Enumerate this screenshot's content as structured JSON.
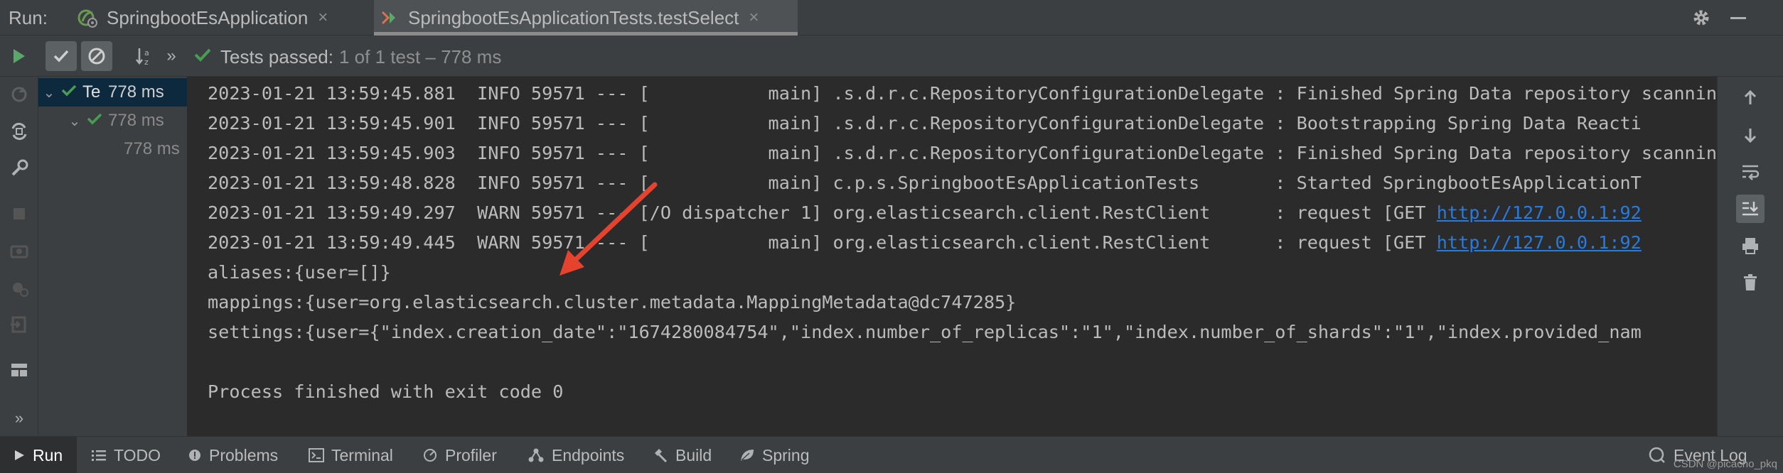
{
  "top_bar": {
    "run_label": "Run:",
    "tabs": [
      {
        "label": "SpringbootEsApplication",
        "icon": "spring-boot-run-icon",
        "active": false
      },
      {
        "label": "SpringbootEsApplicationTests.testSelect",
        "icon": "test-run-icon",
        "active": true
      }
    ],
    "close_glyph": "×"
  },
  "toolbar": {
    "status_label": "Tests passed:",
    "status_count": "1 of 1 test – 778 ms",
    "nav_more": "»"
  },
  "tree": {
    "rows": [
      {
        "name": "Te",
        "time": "778 ms",
        "selected": true,
        "indent": 0
      },
      {
        "name": "",
        "time": "778 ms",
        "selected": false,
        "indent": 1
      },
      {
        "name": "",
        "time": "778 ms",
        "selected": false,
        "indent": 2
      }
    ]
  },
  "console": {
    "lines": [
      {
        "text": "2023-01-21 13:59:45.881  INFO 59571 --- [           main] .s.d.r.c.RepositoryConfigurationDelegate : Finished Spring Data repository scanning",
        "link": ""
      },
      {
        "text": "2023-01-21 13:59:45.901  INFO 59571 --- [           main] .s.d.r.c.RepositoryConfigurationDelegate : Bootstrapping Spring Data Reacti",
        "link": ""
      },
      {
        "text": "2023-01-21 13:59:45.903  INFO 59571 --- [           main] .s.d.r.c.RepositoryConfigurationDelegate : Finished Spring Data repository scanning",
        "link": ""
      },
      {
        "text": "2023-01-21 13:59:48.828  INFO 59571 --- [           main] c.p.s.SpringbootEsApplicationTests       : Started SpringbootEsApplicationT",
        "link": ""
      },
      {
        "text": "2023-01-21 13:59:49.297  WARN 59571 --- [/O dispatcher 1] org.elasticsearch.client.RestClient      : request [GET ",
        "link": "http://127.0.0.1:92"
      },
      {
        "text": "2023-01-21 13:59:49.445  WARN 59571 --- [           main] org.elasticsearch.client.RestClient      : request [GET ",
        "link": "http://127.0.0.1:92"
      },
      {
        "text": "aliases:{user=[]}",
        "link": ""
      },
      {
        "text": "mappings:{user=org.elasticsearch.cluster.metadata.MappingMetadata@dc747285}",
        "link": ""
      },
      {
        "text": "settings:{user={\"index.creation_date\":\"1674280084754\",\"index.number_of_replicas\":\"1\",\"index.number_of_shards\":\"1\",\"index.provided_nam",
        "link": ""
      },
      {
        "text": "",
        "link": ""
      },
      {
        "text": "Process finished with exit code 0",
        "link": ""
      }
    ]
  },
  "bottom_bar": {
    "items": [
      {
        "label": "Run",
        "icon": "run-icon",
        "active": true
      },
      {
        "label": "TODO",
        "icon": "list-icon",
        "active": false
      },
      {
        "label": "Problems",
        "icon": "problems-icon",
        "active": false
      },
      {
        "label": "Terminal",
        "icon": "terminal-icon",
        "active": false
      },
      {
        "label": "Profiler",
        "icon": "profiler-icon",
        "active": false
      },
      {
        "label": "Endpoints",
        "icon": "endpoints-icon",
        "active": false
      },
      {
        "label": "Build",
        "icon": "hammer-icon",
        "active": false
      },
      {
        "label": "Spring",
        "icon": "spring-leaf-icon",
        "active": false
      }
    ],
    "event_log": "Event Log",
    "watermark": "CSDN @picacho_pkq"
  },
  "colors": {
    "pass_green": "#499c54",
    "run_green": "#59a869",
    "link_blue": "#287bde",
    "arrow_red": "#e5432e",
    "selection": "#0d293e"
  }
}
